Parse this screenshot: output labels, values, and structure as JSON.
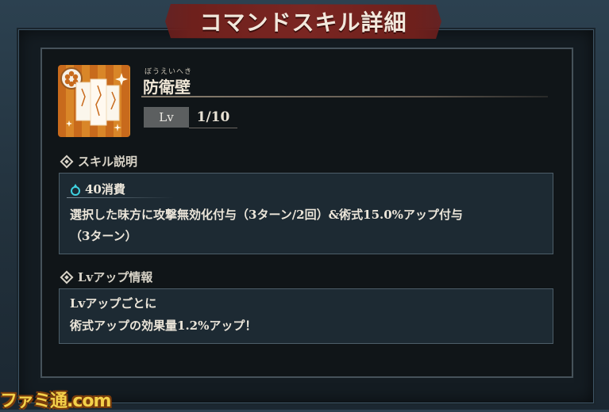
{
  "header": {
    "title": "コマンドスキル詳細"
  },
  "skill": {
    "ruby": "ぼうえいへき",
    "name": "防衛壁",
    "icon": "wall-shield-icon",
    "lv_label": "Lv",
    "lv_value": "1/10"
  },
  "description_section": {
    "heading": "スキル説明",
    "cost_icon": "mana-drop-icon",
    "cost": "40消費",
    "lines": [
      "選択した味方に攻撃無効化付与（3ターン/2回）&術式15.0%アップ付与",
      "（3ターン）"
    ]
  },
  "levelup_section": {
    "heading": "Lvアップ情報",
    "lines": [
      "Lvアップごとに",
      "術式アップの効果量1.2%アップ！"
    ]
  },
  "watermark": "ファミ通.com",
  "colors": {
    "banner": "#7a2622",
    "panel": "#101518",
    "box": "#1d2a33",
    "icon_bg": "#c86a1c",
    "cost_icon": "#3fd1e0"
  }
}
